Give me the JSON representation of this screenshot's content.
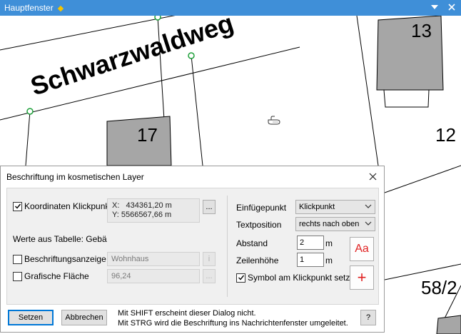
{
  "window": {
    "title": "Hauptfenster",
    "accent": "#3f8fd8"
  },
  "map": {
    "street_label": "Schwarzwaldweg",
    "house_numbers": [
      "13",
      "17",
      "12",
      "58/2"
    ],
    "colors": {
      "building": "#a6a6a6",
      "vertex": "#1ea03a",
      "line": "#000000"
    }
  },
  "dialog": {
    "title": "Beschriftung im kosmetischen Layer",
    "coordinates": {
      "label": "Koordinaten Klickpunkt",
      "checked": true,
      "x_line": "X:   434361,20 m",
      "y_line": "Y: 5566567,66 m",
      "browse": "..."
    },
    "table_values_label": "Werte aus Tabelle: Gebä",
    "label_display": {
      "label": "Beschriftungsanzeige",
      "checked": false,
      "value": "Wohnhaus",
      "info": "i"
    },
    "graphic_area": {
      "label": "Grafische Fläche",
      "checked": false,
      "value": "96,24",
      "browse": "..."
    },
    "insert_point": {
      "label": "Einfügepunkt",
      "value": "Klickpunkt"
    },
    "text_position": {
      "label": "Textposition",
      "value": "rechts nach oben"
    },
    "distance": {
      "label": "Abstand",
      "value": "2",
      "unit": "m"
    },
    "line_height": {
      "label": "Zeilenhöhe",
      "value": "1",
      "unit": "m"
    },
    "symbol": {
      "label": "Symbol am Klickpunkt setzen",
      "checked": true
    },
    "font_button": "Aa",
    "symbol_button": "+",
    "buttons": {
      "set": "Setzen",
      "cancel": "Abbrechen",
      "help": "?"
    },
    "info_line1": "Mit SHIFT erscheint dieser Dialog nicht.",
    "info_line2": "Mit STRG wird die Beschriftung ins Nachrichtenfenster umgeleitet.",
    "accent_red": "#e02020"
  }
}
